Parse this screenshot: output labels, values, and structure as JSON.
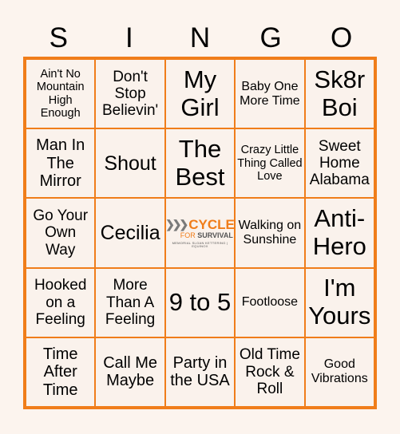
{
  "header": {
    "letters": [
      "S",
      "I",
      "N",
      "G",
      "O"
    ]
  },
  "colors": {
    "accent": "#f07d1a",
    "background": "#fcf4ee",
    "text": "#000000"
  },
  "cells": [
    "Ain't No Mountain High Enough",
    "Don't Stop Believin'",
    "My Girl",
    "Baby One More Time",
    "Sk8r Boi",
    "Man In The Mirror",
    "Shout",
    "The Best",
    "Crazy Little Thing Called Love",
    "Sweet Home Alabama",
    "Go Your Own Way",
    "Cecilia",
    "",
    "Walking on Sunshine",
    "Anti-Hero",
    "Hooked on a Feeling",
    "More Than A Feeling",
    "9 to 5",
    "Footloose",
    "I'm Yours",
    "Time After Time",
    "Call Me Maybe",
    "Party in the USA",
    "Old Time Rock & Roll",
    "Good Vibrations"
  ],
  "free_space": {
    "logo_icon": "chevrons-icon",
    "logo_word1": "CYCLE",
    "logo_word2": "FOR",
    "logo_word3": "SURVIVAL",
    "logo_tagline": "MEMORIAL SLOAN KETTERING | EQUINOX"
  }
}
